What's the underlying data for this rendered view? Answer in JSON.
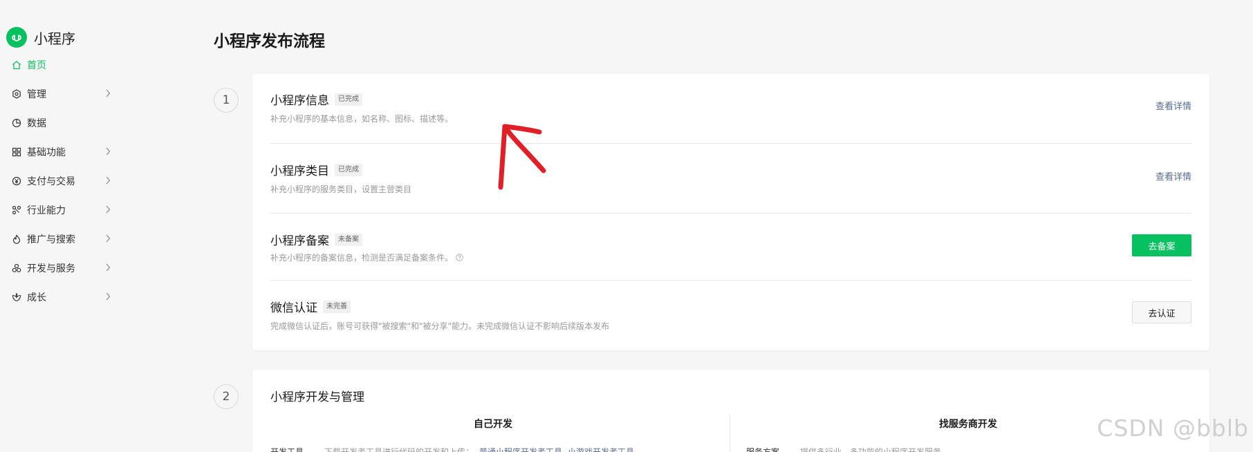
{
  "app": {
    "name": "小程序",
    "brand_color": "#07c160"
  },
  "sidebar": {
    "items": [
      {
        "label": "首页",
        "icon": "home-icon",
        "active": true
      },
      {
        "label": "管理",
        "icon": "settings-icon"
      },
      {
        "label": "数据",
        "icon": "chart-icon"
      },
      {
        "label": "基础功能",
        "icon": "grid-icon"
      },
      {
        "label": "支付与交易",
        "icon": "yen-icon"
      },
      {
        "label": "行业能力",
        "icon": "nodes-icon"
      },
      {
        "label": "推广与搜索",
        "icon": "flame-icon"
      },
      {
        "label": "开发与服务",
        "icon": "cluster-icon"
      },
      {
        "label": "成长",
        "icon": "leaf-icon"
      }
    ]
  },
  "main": {
    "title": "小程序发布流程",
    "step1": {
      "number": "1",
      "rows": [
        {
          "title": "小程序信息",
          "badge": "已完成",
          "desc": "补充小程序的基本信息，如名称、图标、描述等。",
          "action": "查看详情"
        },
        {
          "title": "小程序类目",
          "badge": "已完成",
          "desc": "补充小程序的服务类目，设置主营类目",
          "action": "查看详情"
        },
        {
          "title": "小程序备案",
          "badge": "未备案",
          "desc": "补充小程序的备案信息，检测是否满足备案条件。",
          "action": "去备案"
        },
        {
          "title": "微信认证",
          "badge": "未完善",
          "desc": "完成微信认证后，账号可获得\"被搜索\"和\"被分享\"能力。未完成微信认证不影响后续版本发布",
          "action": "去认证"
        }
      ]
    },
    "step2": {
      "number": "2",
      "title": "小程序开发与管理",
      "left_column": {
        "heading": "自己开发",
        "row_label": "开发工具",
        "row_desc": "下载开发者工具进行代码的开发和上传：",
        "links": [
          "普通小程序开发者工具",
          "小游戏开发者工具"
        ]
      },
      "right_column": {
        "heading": "找服务商开发",
        "row_label": "服务方案",
        "row_desc": "提供多行业、多功能的小程序开发服务"
      }
    }
  },
  "watermark": "CSDN @bblb"
}
